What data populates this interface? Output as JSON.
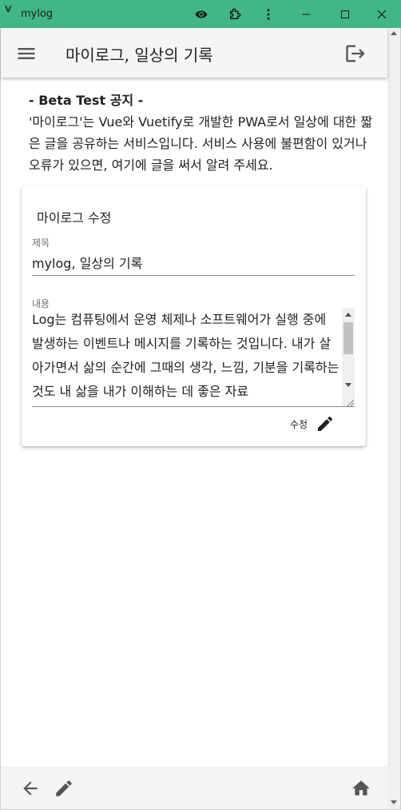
{
  "window": {
    "app_name": "mylog",
    "app_icon": "V",
    "colors": {
      "titlebar": "#41b883"
    },
    "icons": [
      "eye-icon",
      "extension-icon",
      "more-vert-icon",
      "minimize-icon",
      "maximize-icon",
      "close-icon"
    ]
  },
  "appbar": {
    "title": "마이로그, 일상의 기록",
    "icons": [
      "menu-icon",
      "logout-icon"
    ]
  },
  "notice": {
    "heading": "- Beta Test 공지 -",
    "body": "'마이로그'는 Vue와 Vuetify로 개발한 PWA로서 일상에 대한 짧은 글을 공유하는 서비스입니다. 서비스 사용에 불편함이 있거나 오류가 있으면, 여기에 글을 써서 알려 주세요."
  },
  "card": {
    "title": "마이로그 수정",
    "title_label": "제목",
    "title_value": "mylog, 일상의 기록",
    "content_label": "내용",
    "content_value": "Log는 컴퓨팅에서 운영 체제나 소프트웨어가 실행 중에 발생하는 이벤트나 메시지를 기록하는 것입니다. 내가 살아가면서 삶의 순간에 그때의 생각, 느낌, 기분을 기록하는 것도 내 삶을 내가 이해하는 데 좋은 자료",
    "submit_label": "수정",
    "submit_icon": "pencil-icon"
  },
  "bottombar": {
    "icons": [
      "arrow-back-icon",
      "pencil-icon",
      "home-icon"
    ]
  }
}
